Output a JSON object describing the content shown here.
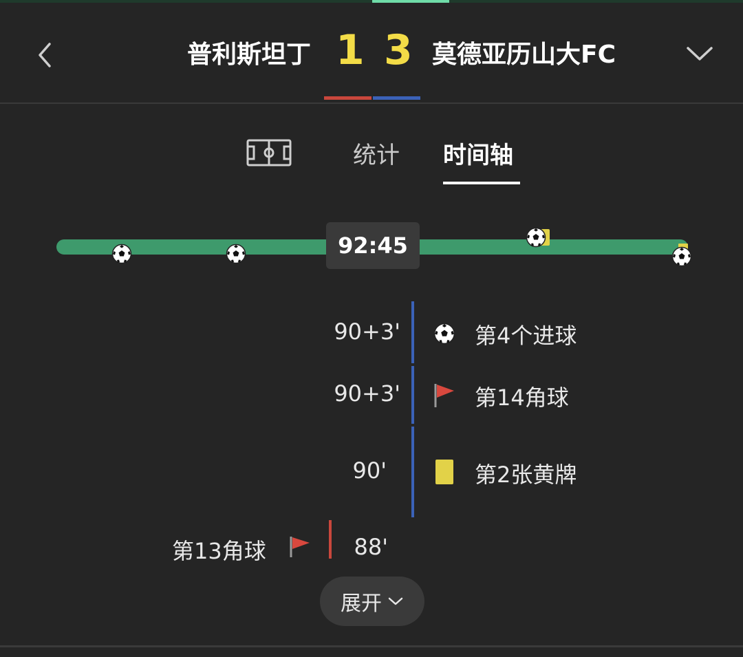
{
  "header": {
    "home_team": "普利斯坦丁",
    "away_team": "莫德亚历山大FC",
    "home_score": "1",
    "away_score": "3",
    "back_icon": "chevron-left-icon",
    "more_icon": "chevron-down-icon"
  },
  "tabs": {
    "pitch_icon": "pitch-icon",
    "stats_label": "统计",
    "timeline_label": "时间轴",
    "active": "时间轴"
  },
  "timeline": {
    "current_time": "92:45",
    "markers": [
      {
        "icon": "soccer-ball-icon"
      },
      {
        "icon": "soccer-ball-icon"
      },
      {
        "icon": "soccer-ball-icon"
      },
      {
        "icon": "yellow-card-icon"
      },
      {
        "icon": "soccer-ball-icon"
      }
    ]
  },
  "events": [
    {
      "time": "90+3'",
      "label": "第4个进球",
      "icon": "soccer-ball-icon",
      "side": "away"
    },
    {
      "time": "90+3'",
      "label": "第14角球",
      "icon": "corner-flag-icon",
      "side": "away"
    },
    {
      "time": "90'",
      "label": "第2张黄牌",
      "icon": "yellow-card-icon",
      "side": "away"
    },
    {
      "time": "88'",
      "label": "第13角球",
      "icon": "corner-flag-icon",
      "side": "home"
    }
  ],
  "expand_label": "展开",
  "colors": {
    "background": "#252525",
    "score": "#f3dc47",
    "home": "#c9473c",
    "away": "#3b62b8",
    "track": "#3e9a6c",
    "yellow_card": "#e2d248"
  }
}
